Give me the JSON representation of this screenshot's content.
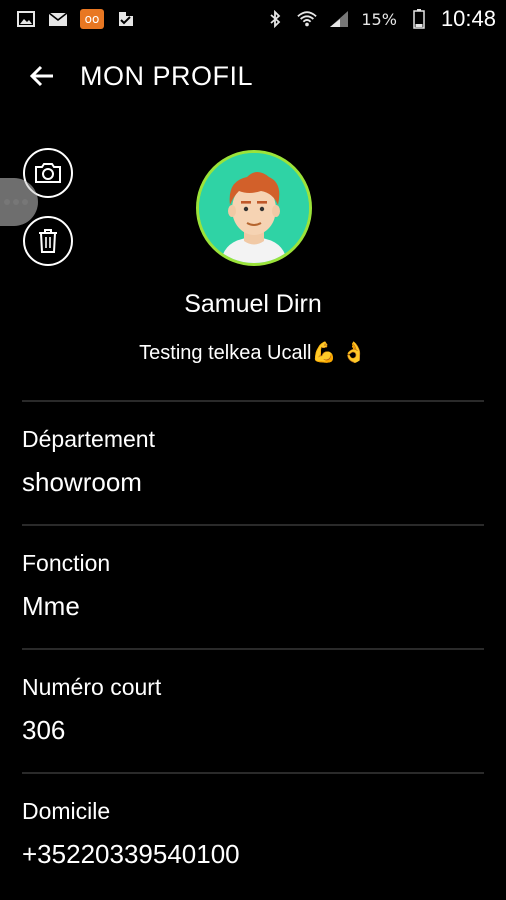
{
  "status_bar": {
    "left_icons": [
      "image-icon",
      "mail-icon",
      "voicemail-icon",
      "check-icon"
    ],
    "voicemail_glyph": "oo",
    "right_icons": [
      "bluetooth-icon",
      "wifi-icon",
      "signal-icon",
      "battery-icon"
    ],
    "battery_percent": "15%",
    "time": "10:48"
  },
  "header": {
    "title": "MON PROFIL"
  },
  "profile": {
    "name": "Samuel Dirn",
    "status": "Testing telkea Ucall💪 👌"
  },
  "fields": [
    {
      "label": "Département",
      "value": "showroom"
    },
    {
      "label": "Fonction",
      "value": "Mme"
    },
    {
      "label": "Numéro court",
      "value": "306"
    },
    {
      "label": "Domicile",
      "value": "+35220339540100"
    }
  ],
  "colors": {
    "avatar_bg": "#2fd3a5",
    "avatar_ring": "#9be33a",
    "voicemail": "#e87722"
  }
}
